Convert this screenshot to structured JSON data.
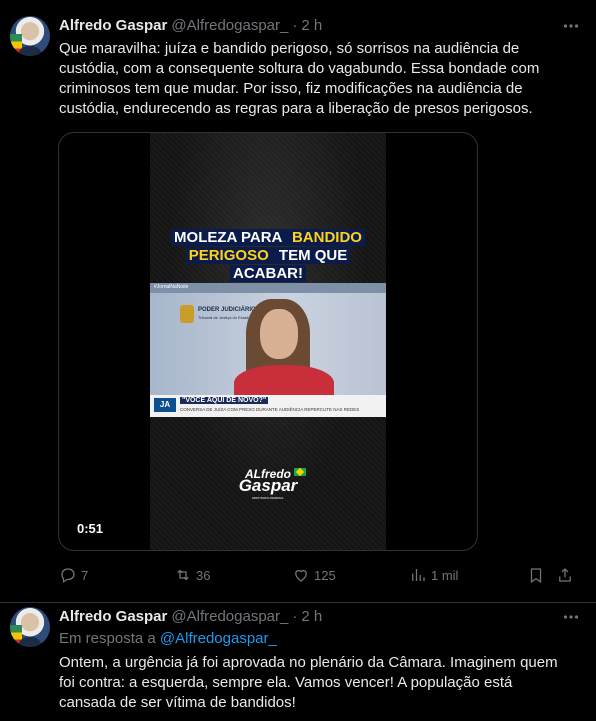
{
  "tweets": [
    {
      "author": {
        "name": "Alfredo Gaspar",
        "handle": "@Alfredogaspar_",
        "time": "2 h"
      },
      "text": "Que maravilha: juíza e bandido perigoso, só sorrisos na audiência de custódia, com a consequente soltura do vagabundo. Essa bondade com criminosos tem que mudar. Por isso, fiz modificações na audiência de custódia, endurecendo as regras para a liberação de presos perigosos.",
      "media": {
        "headline_parts": [
          {
            "text": "MOLEZA PARA ",
            "highlight": false
          },
          {
            "text": "BANDIDO",
            "highlight": true
          },
          {
            "text": "PERIGOSO",
            "highlight": true
          },
          {
            "text": " TEM QUE",
            "highlight": false
          },
          {
            "text": "ACABAR!",
            "highlight": false
          }
        ],
        "clip": {
          "top_tag": "#JornalNaNoite",
          "poder": "PODER JUDICIÁRIO",
          "tribunal": "Tribunal de Justiça do Estado de ...",
          "logo": "JA",
          "caption": "\"VOCÊ AQUI DE NOVO?\"",
          "subcaption": "CONVERSA DE JUÍZA COM PRESO DURANTE AUDIÊNCIA REPERCUTE NAS REDES"
        },
        "brand": {
          "line1": "ALfredo",
          "line2": "Gaspar",
          "tag": "DEPUTADO FEDERAL"
        },
        "duration": "0:51"
      },
      "actions": {
        "reply": "7",
        "retweet": "36",
        "like": "125",
        "views": "1 mil"
      },
      "colors": {
        "accent": "#1d9bf0",
        "muted": "#71767b",
        "text": "#e7e9ea"
      }
    },
    {
      "author": {
        "name": "Alfredo Gaspar",
        "handle": "@Alfredogaspar_",
        "time": "2 h"
      },
      "reply_prefix": "Em resposta a",
      "reply_handle": "@Alfredogaspar_",
      "text": "Ontem, a urgência já foi aprovada no plenário da Câmara. Imaginem quem foi contra: a esquerda, sempre ela. Vamos vencer! A população está cansada de ser vítima de bandidos!"
    }
  ]
}
